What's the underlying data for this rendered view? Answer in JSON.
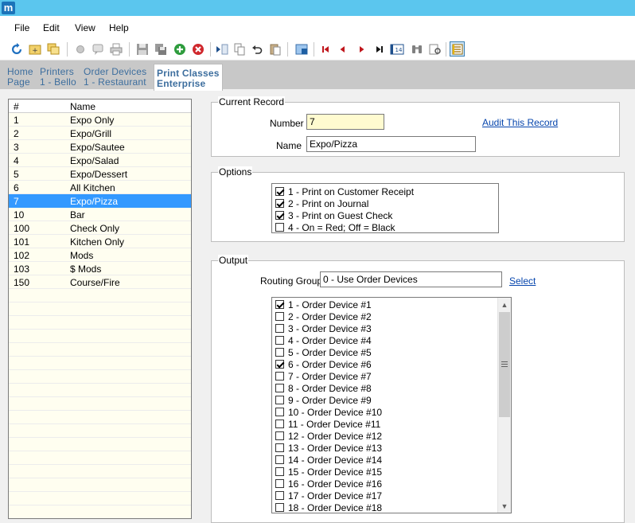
{
  "app": {
    "logo_letter": "m",
    "accent_color": "#5bc6ee"
  },
  "menu": {
    "items": [
      "File",
      "Edit",
      "View",
      "Help"
    ]
  },
  "toolbar": {
    "icons": [
      "refresh-icon",
      "new-folder-icon",
      "copy-folder-icon",
      "record-icon",
      "comment-icon",
      "print-icon",
      "save-icon",
      "save-all-icon",
      "add-icon",
      "delete-icon",
      "move-icon",
      "copy-icon",
      "undo-icon",
      "paste-icon",
      "export-icon",
      "first-record-icon",
      "previous-record-icon",
      "next-record-icon",
      "last-record-icon",
      "go-to-record-icon",
      "find-icon",
      "find-next-icon",
      "list-view-icon"
    ]
  },
  "breadcrumb": [
    {
      "line1": "Home",
      "line2": "Page"
    },
    {
      "line1": "Printers",
      "line2": "1 - Bello"
    },
    {
      "line1": "Order Devices",
      "line2": "1 - Restaurant"
    },
    {
      "line1": "Print Classes",
      "line2": "Enterprise"
    }
  ],
  "list": {
    "columns": [
      "#",
      "Name"
    ],
    "rows": [
      {
        "num": "1",
        "name": "Expo Only"
      },
      {
        "num": "2",
        "name": "Expo/Grill"
      },
      {
        "num": "3",
        "name": "Expo/Sautee"
      },
      {
        "num": "4",
        "name": "Expo/Salad"
      },
      {
        "num": "5",
        "name": "Expo/Dessert"
      },
      {
        "num": "6",
        "name": "All Kitchen"
      },
      {
        "num": "7",
        "name": "Expo/Pizza"
      },
      {
        "num": "10",
        "name": "Bar"
      },
      {
        "num": "100",
        "name": "Check Only"
      },
      {
        "num": "101",
        "name": "Kitchen Only"
      },
      {
        "num": "102",
        "name": "Mods"
      },
      {
        "num": "103",
        "name": "$ Mods"
      },
      {
        "num": "150",
        "name": "Course/Fire"
      }
    ],
    "selected_index": 6,
    "selected_color": "#3399ff",
    "row_color": "#fffef0"
  },
  "current_record": {
    "label": "Current Record",
    "number_label": "Number",
    "number_value": "7",
    "name_label": "Name",
    "name_value": "Expo/Pizza",
    "audit_link": "Audit This Record"
  },
  "options": {
    "label": "Options",
    "items": [
      {
        "label": "1 - Print on Customer Receipt",
        "checked": true
      },
      {
        "label": "2 - Print on Journal",
        "checked": true
      },
      {
        "label": "3 - Print on Guest Check",
        "checked": true
      },
      {
        "label": "4 - On = Red; Off = Black",
        "checked": false
      }
    ]
  },
  "output": {
    "label": "Output",
    "routing_label": "Routing Group",
    "routing_value": "0 - Use Order Devices",
    "select_link": "Select",
    "devices": [
      {
        "label": "1 - Order Device #1",
        "checked": true
      },
      {
        "label": "2 - Order Device #2",
        "checked": false
      },
      {
        "label": "3 - Order Device #3",
        "checked": false
      },
      {
        "label": "4 - Order Device #4",
        "checked": false
      },
      {
        "label": "5 - Order Device #5",
        "checked": false
      },
      {
        "label": "6 - Order Device #6",
        "checked": true
      },
      {
        "label": "7 - Order Device #7",
        "checked": false
      },
      {
        "label": "8 - Order Device #8",
        "checked": false
      },
      {
        "label": "9 - Order Device #9",
        "checked": false
      },
      {
        "label": "10 - Order Device #10",
        "checked": false
      },
      {
        "label": "11 - Order Device #11",
        "checked": false
      },
      {
        "label": "12 - Order Device #12",
        "checked": false
      },
      {
        "label": "13 - Order Device #13",
        "checked": false
      },
      {
        "label": "14 - Order Device #14",
        "checked": false
      },
      {
        "label": "15 - Order Device #15",
        "checked": false
      },
      {
        "label": "16 - Order Device #16",
        "checked": false
      },
      {
        "label": "17 - Order Device #17",
        "checked": false
      },
      {
        "label": "18 - Order Device #18",
        "checked": false
      }
    ],
    "scroll_position": 0.0
  }
}
